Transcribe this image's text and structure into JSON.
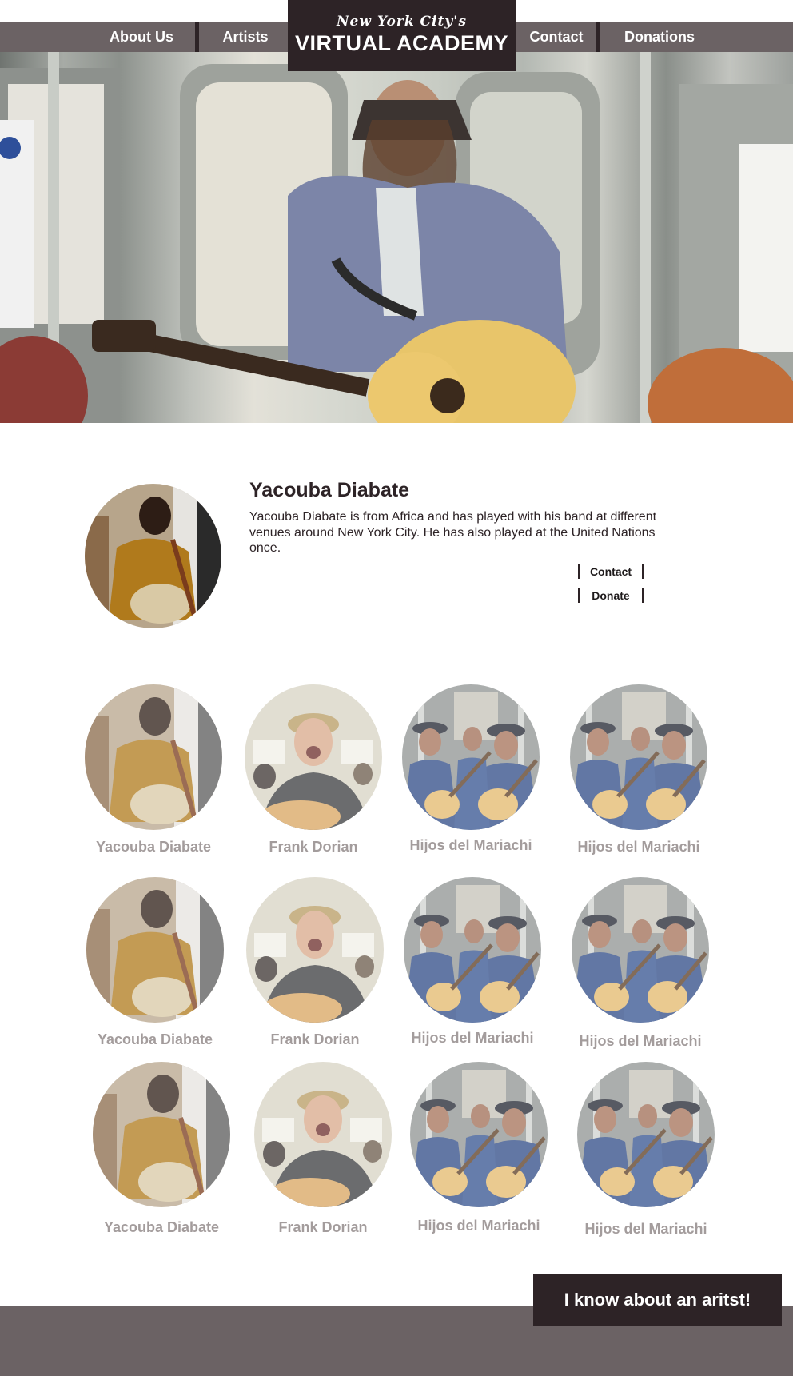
{
  "nav": {
    "about": "About Us",
    "artists": "Artists",
    "contact": "Contact",
    "donations": "Donations"
  },
  "logo": {
    "tagline": "New York City's",
    "title": "VIRTUAL ACADEMY"
  },
  "featured": {
    "name": "Yacouba Diabate",
    "bio": "Yacouba Diabate is from Africa and has played with his band at different venues around New York City. He has also played at the United Nations once.",
    "contact_label": "Contact",
    "donate_label": "Donate"
  },
  "artists": [
    [
      "Yacouba Diabate",
      "Frank Dorian",
      "Hijos del Mariachi",
      "Hijos del Mariachi"
    ],
    [
      "Yacouba Diabate",
      "Frank Dorian",
      "Hijos del Mariachi",
      "Hijos del Mariachi"
    ],
    [
      "Yacouba Diabate",
      "Frank Dorian",
      "Hijos del Mariachi",
      "Hijos del Mariachi"
    ]
  ],
  "cta_label": "I know about an aritst!"
}
